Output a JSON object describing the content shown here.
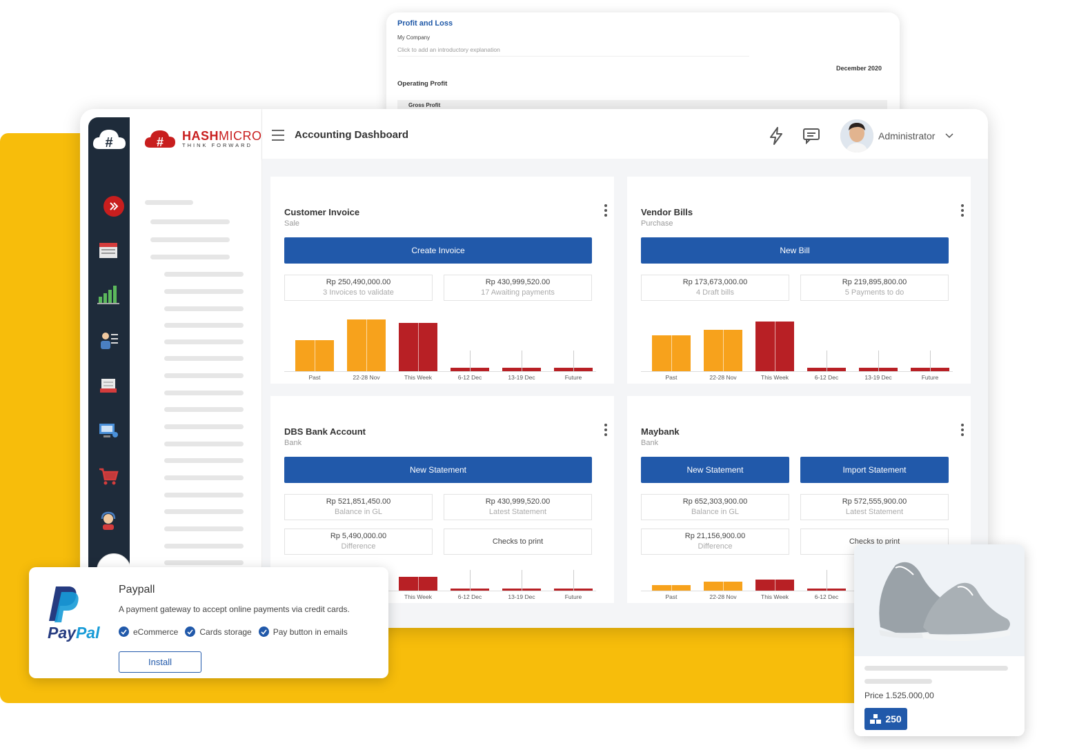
{
  "pnl": {
    "title": "Profit and Loss",
    "company": "My Company",
    "intro_placeholder": "Click to add an introductory explanation",
    "date": "December 2020",
    "operating": "Operating Profit",
    "gross": "Gross Profit"
  },
  "brand": {
    "name_bold": "HASH",
    "name_rest": "MICRO",
    "tagline": "THINK FORWARD"
  },
  "header": {
    "title": "Accounting Dashboard",
    "user": "Administrator"
  },
  "colors": {
    "primary": "#2159aa",
    "orange": "#f7a21c",
    "red": "#b82025",
    "yellow": "#f7bd0b"
  },
  "cards": [
    {
      "title": "Customer Invoice",
      "subtitle": "Sale",
      "buttons": [
        "Create Invoice"
      ],
      "stats": [
        {
          "amount": "Rp 250,490,000.00",
          "label": "3 Invoices to validate"
        },
        {
          "amount": "Rp 430,999,520.00",
          "label": "17 Awaiting payments"
        }
      ]
    },
    {
      "title": "Vendor Bills",
      "subtitle": "Purchase",
      "buttons": [
        "New Bill"
      ],
      "stats": [
        {
          "amount": "Rp 173,673,000.00",
          "label": "4 Draft bills"
        },
        {
          "amount": "Rp 219,895,800.00",
          "label": "5 Payments to do"
        }
      ]
    },
    {
      "title": "DBS Bank Account",
      "subtitle": "Bank",
      "buttons": [
        "New Statement"
      ],
      "stats": [
        {
          "amount": "Rp 521,851,450.00",
          "label": "Balance in GL"
        },
        {
          "amount": "Rp 430,999,520.00",
          "label": "Latest Statement"
        },
        {
          "amount": "Rp 5,490,000.00",
          "label": "Difference"
        },
        {
          "amount": "Checks to print",
          "label": ""
        }
      ]
    },
    {
      "title": "Maybank",
      "subtitle": "Bank",
      "buttons": [
        "New Statement",
        "Import Statement"
      ],
      "stats": [
        {
          "amount": "Rp 652,303,900.00",
          "label": "Balance in GL"
        },
        {
          "amount": "Rp 572,555,900.00",
          "label": "Latest Statement"
        },
        {
          "amount": "Rp 21,156,900.00",
          "label": "Difference"
        },
        {
          "amount": "Checks to print",
          "label": ""
        }
      ]
    }
  ],
  "chart_data": [
    {
      "type": "bar",
      "categories": [
        "Past",
        "22-28 Nov",
        "This Week",
        "6-12 Dec",
        "13-19 Dec",
        "Future"
      ],
      "values": [
        45,
        75,
        70,
        5,
        5,
        5
      ]
    },
    {
      "type": "bar",
      "categories": [
        "Past",
        "22-28 Nov",
        "This Week",
        "6-12 Dec",
        "13-19 Dec",
        "Future"
      ],
      "values": [
        52,
        60,
        72,
        5,
        5,
        5
      ]
    },
    {
      "type": "bar",
      "categories": [
        "Past",
        "22-28 Nov",
        "This Week",
        "6-12 Dec",
        "13-19 Dec",
        "Future"
      ],
      "values": [
        42,
        32,
        50,
        5,
        5,
        5
      ]
    },
    {
      "type": "bar",
      "categories": [
        "Past",
        "22-28 Nov",
        "This Week",
        "6-12 Dec"
      ],
      "values": [
        20,
        32,
        40,
        5
      ]
    }
  ],
  "paypal": {
    "wordmark_a": "Pay",
    "wordmark_b": "Pal",
    "title": "Paypall",
    "description": "A payment gateway to accept online payments via credit cards.",
    "features": [
      "eCommerce",
      "Cards storage",
      "Pay button in emails"
    ],
    "install": "Install"
  },
  "product": {
    "price": "Price 1.525.000,00",
    "stock": "250"
  }
}
